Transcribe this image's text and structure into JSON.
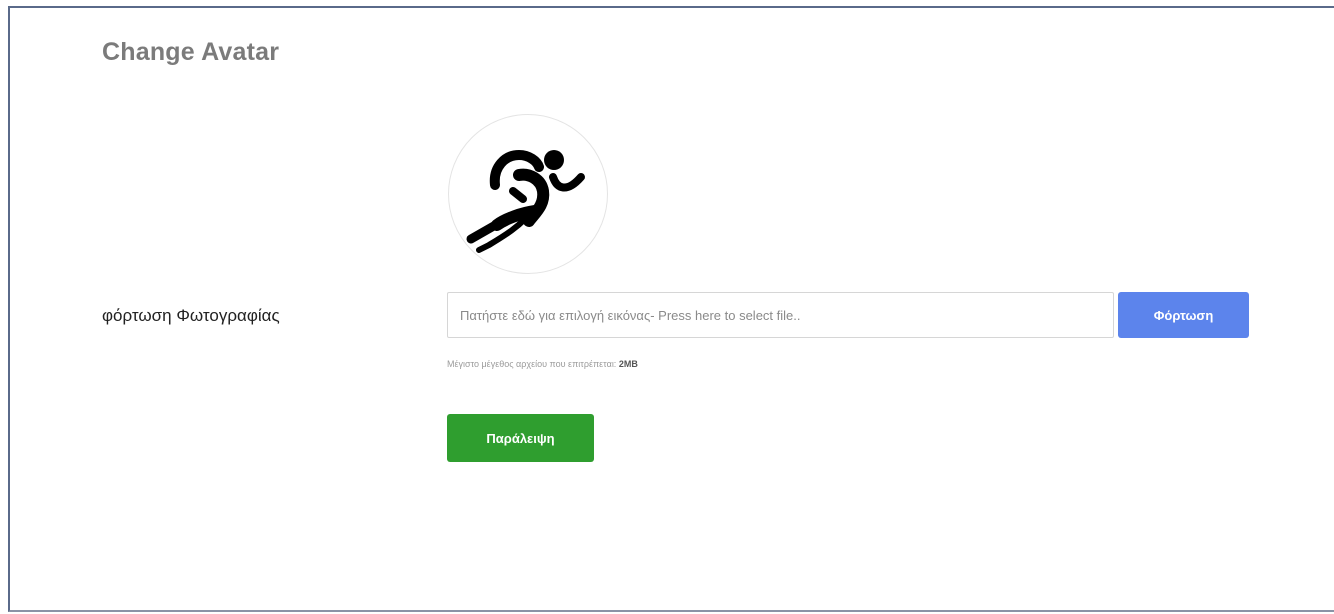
{
  "page": {
    "title": "Change Avatar"
  },
  "avatar": {
    "icon": "runner-icon"
  },
  "upload": {
    "label": "φόρτωση Φωτογραφίας",
    "input_placeholder": "Πατήστε εδώ για επιλογή εικόνας- Press here to select file..",
    "upload_button_label": "Φόρτωση",
    "hint_text": "Μέγιστο μέγεθος αρχείου που επιτρέπεται:",
    "hint_value": "2MB"
  },
  "actions": {
    "skip_label": "Παράλειψη"
  },
  "colors": {
    "upload_button": "#5c84ec",
    "skip_button": "#2f9e2f",
    "title": "#7b7b7b"
  }
}
